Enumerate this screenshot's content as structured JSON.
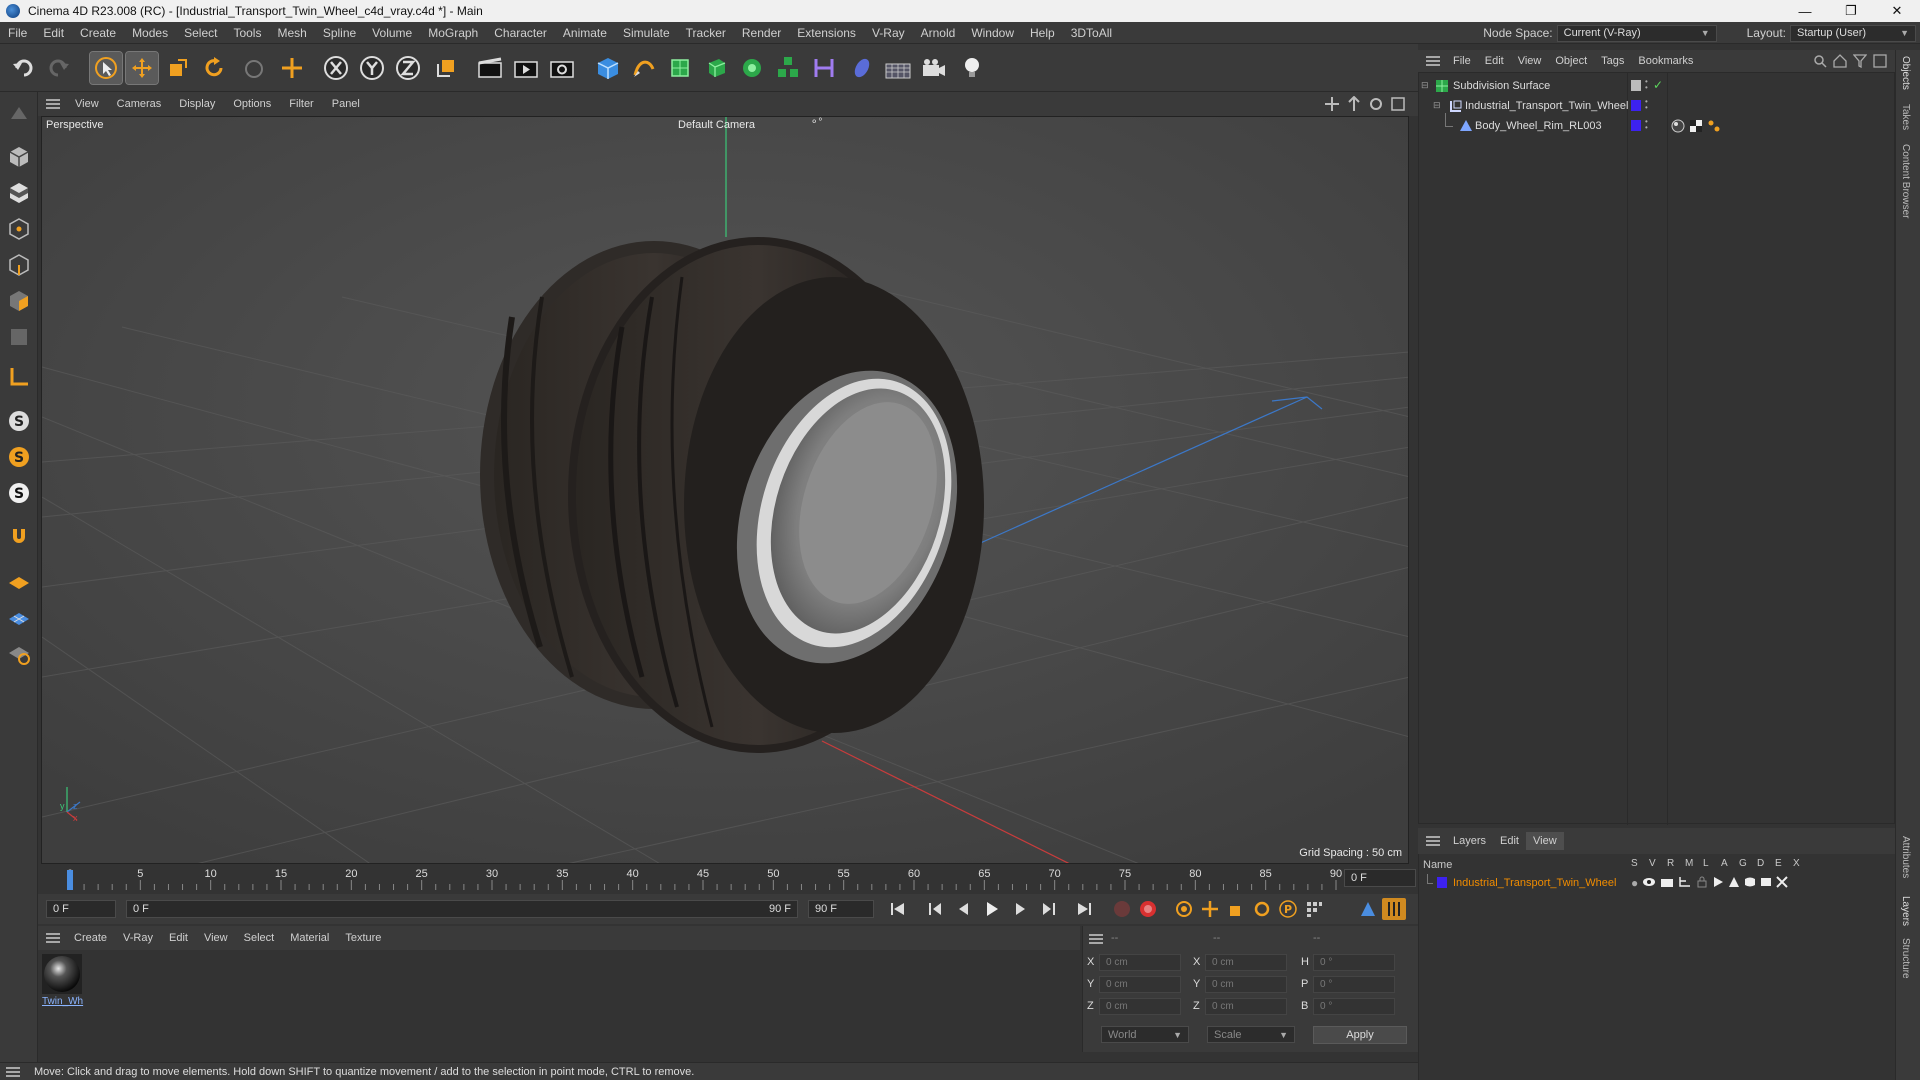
{
  "window": {
    "title": "Cinema 4D R23.008 (RC) - [Industrial_Transport_Twin_Wheel_c4d_vray.c4d *] - Main",
    "min": "—",
    "max": "❐",
    "close": "✕"
  },
  "menu": [
    "File",
    "Edit",
    "Create",
    "Modes",
    "Select",
    "Tools",
    "Mesh",
    "Spline",
    "Volume",
    "MoGraph",
    "Character",
    "Animate",
    "Simulate",
    "Tracker",
    "Render",
    "Extensions",
    "V-Ray",
    "Arnold",
    "Window",
    "Help",
    "3DToAll"
  ],
  "node_space": {
    "label": "Node Space:",
    "value": "Current (V-Ray)"
  },
  "layout": {
    "label": "Layout:",
    "value": "Startup (User)"
  },
  "viewport": {
    "menu": [
      "View",
      "Cameras",
      "Display",
      "Options",
      "Filter",
      "Panel"
    ],
    "name": "Perspective",
    "camera": "Default Camera",
    "grid_spacing": "Grid Spacing : 50 cm"
  },
  "timeline": {
    "ticks": [
      "0",
      "5",
      "10",
      "15",
      "20",
      "25",
      "30",
      "35",
      "40",
      "45",
      "50",
      "55",
      "60",
      "65",
      "70",
      "75",
      "80",
      "85",
      "90"
    ],
    "current": "0 F",
    "start": "0 F",
    "range_start": "0 F",
    "range_end": "90 F",
    "end": "90 F"
  },
  "material": {
    "menu": [
      "Create",
      "V-Ray",
      "Edit",
      "View",
      "Select",
      "Material",
      "Texture"
    ],
    "item_label": "Twin_Wh"
  },
  "coords": {
    "headers": [
      "--",
      "--",
      "--"
    ],
    "rows": [
      {
        "l1": "X",
        "v1": "0 cm",
        "l2": "X",
        "v2": "0 cm",
        "l3": "H",
        "v3": "0 °"
      },
      {
        "l1": "Y",
        "v1": "0 cm",
        "l2": "Y",
        "v2": "0 cm",
        "l3": "P",
        "v3": "0 °"
      },
      {
        "l1": "Z",
        "v1": "0 cm",
        "l2": "Z",
        "v2": "0 cm",
        "l3": "B",
        "v3": "0 °"
      }
    ],
    "space": "World",
    "mode": "Scale",
    "apply": "Apply"
  },
  "status": "Move: Click and drag to move elements. Hold down SHIFT to quantize movement / add to the selection in point mode, CTRL to remove.",
  "objects": {
    "menu": [
      "File",
      "Edit",
      "View",
      "Object",
      "Tags",
      "Bookmarks"
    ],
    "items": [
      {
        "name": "Subdivision Surface",
        "color": "#cccccc"
      },
      {
        "name": "Industrial_Transport_Twin_Wheel",
        "color": "#3d22f0"
      },
      {
        "name": "Body_Wheel_Rim_RL003",
        "color": "#3d22f0"
      }
    ]
  },
  "layers": {
    "menu": [
      "Layers",
      "Edit",
      "View"
    ],
    "name_header": "Name",
    "flags": [
      "S",
      "V",
      "R",
      "M",
      "L",
      "A",
      "G",
      "D",
      "E",
      "X"
    ],
    "items": [
      {
        "name": "Industrial_Transport_Twin_Wheel",
        "color": "#3d22f0",
        "text_color": "#f08c00"
      }
    ]
  },
  "side_tabs": [
    "Objects",
    "Takes",
    "Content Browser",
    "Attributes",
    "Layers",
    "Structure"
  ],
  "colors": {
    "accent": "#3d22f0",
    "layer_text": "#f08c00",
    "axis_x": "#c83c3c",
    "axis_y": "#3cc878",
    "axis_z": "#3c78c8"
  }
}
